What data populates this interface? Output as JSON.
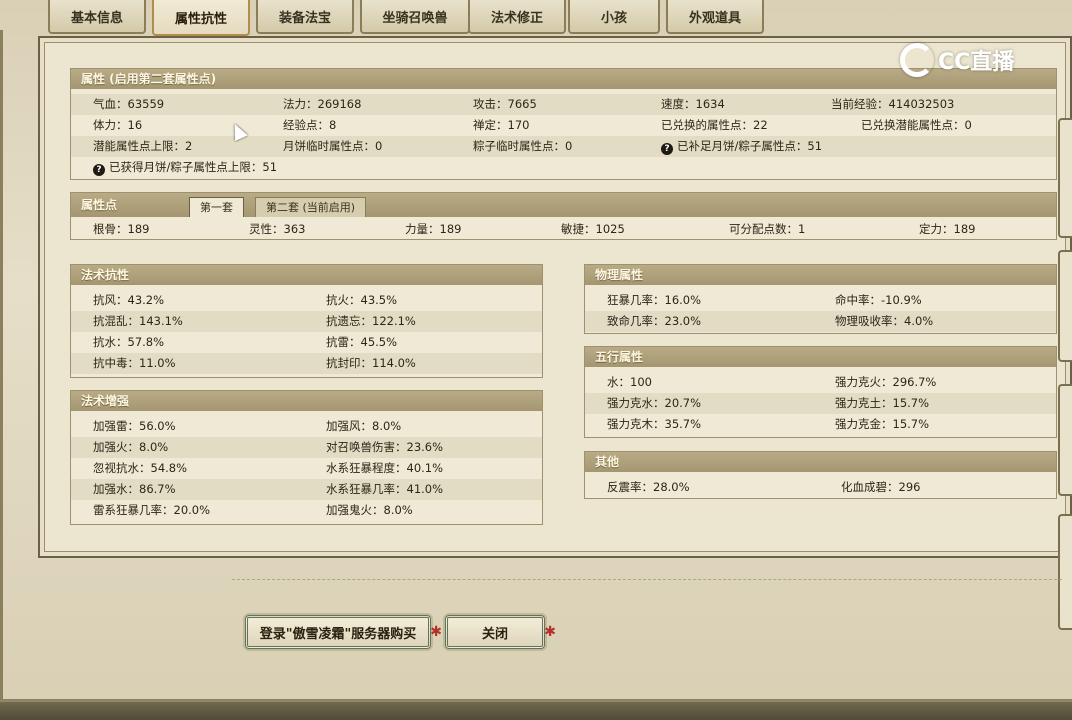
{
  "tabs": [
    "基本信息",
    "属性抗性",
    "装备法宝",
    "坐骑召唤兽",
    "法术修正",
    "小孩",
    "外观道具"
  ],
  "active_tab": 1,
  "watermark": "CC直播",
  "attributes": {
    "header": "属性 (启用第二套属性点)",
    "rows": [
      [
        "气血：63559",
        "法力：269168",
        "攻击：7665",
        "速度：1634",
        "当前经验：414032503"
      ],
      [
        "体力：16",
        "经验点：8",
        "禅定：170",
        "已兑换的属性点：22",
        "已兑换潜能属性点：0"
      ],
      [
        "潜能属性点上限：2",
        "月饼临时属性点：0",
        "粽子临时属性点：0",
        "已补足月饼/粽子属性点：51",
        ""
      ],
      [
        "已获得月饼/粽子属性点上限：51",
        "",
        "",
        "",
        ""
      ]
    ]
  },
  "points": {
    "header": "属性点",
    "subtabs": [
      "第一套",
      "第二套 (当前启用)"
    ],
    "values": [
      "根骨：189",
      "灵性：363",
      "力量：189",
      "敏捷：1025",
      "可分配点数：1",
      "定力：189"
    ]
  },
  "spell_resist": {
    "header": "法术抗性",
    "rows": [
      [
        "抗风：43.2%",
        "抗火：43.5%"
      ],
      [
        "抗混乱：143.1%",
        "抗遗忘：122.1%"
      ],
      [
        "抗水：57.8%",
        "抗雷：45.5%"
      ],
      [
        "抗中毒：11.0%",
        "抗封印：114.0%"
      ]
    ]
  },
  "spell_boost": {
    "header": "法术增强",
    "rows": [
      [
        "加强雷：56.0%",
        "加强风：8.0%"
      ],
      [
        "加强火：8.0%",
        "对召唤兽伤害：23.6%"
      ],
      [
        "忽视抗水：54.8%",
        "水系狂暴程度：40.1%"
      ],
      [
        "加强水：86.7%",
        "水系狂暴几率：41.0%"
      ],
      [
        "雷系狂暴几率：20.0%",
        "加强鬼火：8.0%"
      ]
    ]
  },
  "physical": {
    "header": "物理属性",
    "rows": [
      [
        "狂暴几率：16.0%",
        "命中率：-10.9%"
      ],
      [
        "致命几率：23.0%",
        "物理吸收率：4.0%"
      ]
    ]
  },
  "five_elements": {
    "header": "五行属性",
    "rows": [
      [
        "水：100",
        "强力克火：296.7%"
      ],
      [
        "强力克水：20.7%",
        "强力克土：15.7%"
      ],
      [
        "强力克木：35.7%",
        "强力克金：15.7%"
      ]
    ]
  },
  "other": {
    "header": "其他",
    "rows": [
      [
        "反震率：28.0%",
        "化血成碧：296"
      ]
    ]
  },
  "buttons": {
    "buy": "登录\"傲雪凌霜\"服务器购买",
    "close": "关闭"
  }
}
